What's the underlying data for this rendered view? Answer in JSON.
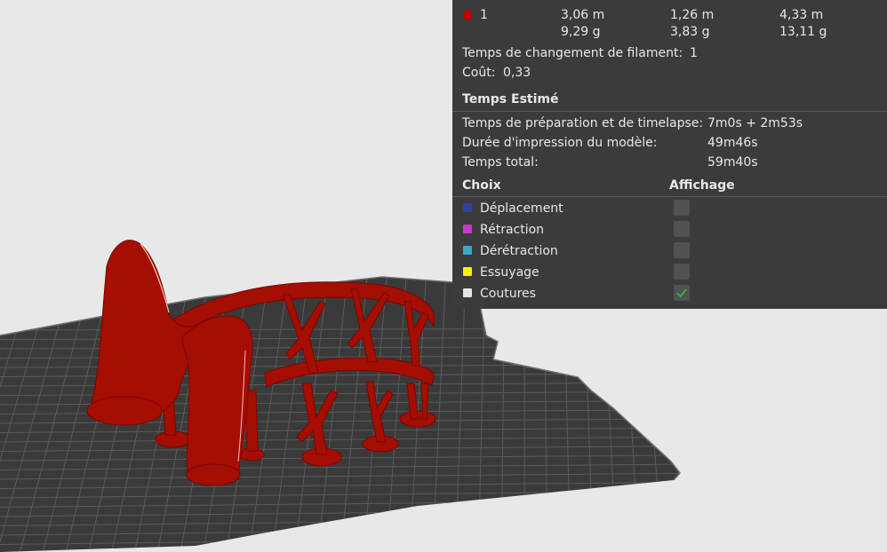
{
  "filament_row": {
    "index": "1",
    "color": "#c00000",
    "col1": [
      "3,06 m",
      "9,29 g"
    ],
    "col2": [
      "1,26 m",
      "3,83 g"
    ],
    "col3": [
      "4,33 m",
      "13,11 g"
    ]
  },
  "filament_change": {
    "label": "Temps de changement de filament:",
    "value": "1"
  },
  "cost": {
    "label": "Coût:",
    "value": "0,33"
  },
  "estimated": {
    "title": "Temps Estimé",
    "rows": [
      {
        "label": "Temps de préparation et de timelapse:",
        "value": "7m0s + 2m53s"
      },
      {
        "label": "Durée d'impression du modèle:",
        "value": "49m46s"
      },
      {
        "label": "Temps total:",
        "value": "59m40s"
      }
    ]
  },
  "options_header": {
    "choice": "Choix",
    "display": "Affichage"
  },
  "options": [
    {
      "label": "Déplacement",
      "color": "#2d3fa8",
      "checked": false
    },
    {
      "label": "Rétraction",
      "color": "#c23ad0",
      "checked": false
    },
    {
      "label": "Dérétraction",
      "color": "#39a6c9",
      "checked": false
    },
    {
      "label": "Essuyage",
      "color": "#f5f200",
      "checked": false
    },
    {
      "label": "Coutures",
      "color": "#e4e4e4",
      "checked": true
    }
  ],
  "colors": {
    "panel_bg": "#3b3b3b",
    "viewport_bg": "#e8e8e8",
    "plate": "#3a3a3a",
    "plate_grid": "#5d5d5d",
    "model": "#a50e02",
    "check": "#2fb04a"
  }
}
